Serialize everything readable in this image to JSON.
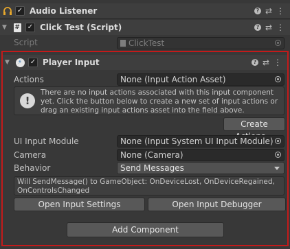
{
  "audio_listener": {
    "title": "Audio Listener"
  },
  "click_test": {
    "title": "Click Test (Script)",
    "script_label": "Script",
    "script_value": "ClickTest"
  },
  "player_input": {
    "title": "Player Input",
    "actions_label": "Actions",
    "actions_value": "None (Input Action Asset)",
    "help_text": "There are no input actions associated with this input component yet. Click the button below to create a new set of input actions or drag an existing input actions asset into the field above.",
    "create_actions_button": "Create Actions...",
    "ui_input_module_label": "UI Input Module",
    "ui_input_module_value": "None (Input System UI Input Module)",
    "camera_label": "Camera",
    "camera_value": "None (Camera)",
    "behavior_label": "Behavior",
    "behavior_value": "Send Messages",
    "send_message_info": "Will SendMessage() to GameObject: OnDeviceLost, OnDeviceRegained, OnControlsChanged",
    "open_input_settings_button": "Open Input Settings",
    "open_input_debugger_button": "Open Input Debugger"
  },
  "add_component_button": "Add Component",
  "colors": {
    "highlight_border": "#c41a1a",
    "accent_green": "#3c9a3c",
    "accent_blue": "#4a9de0"
  }
}
